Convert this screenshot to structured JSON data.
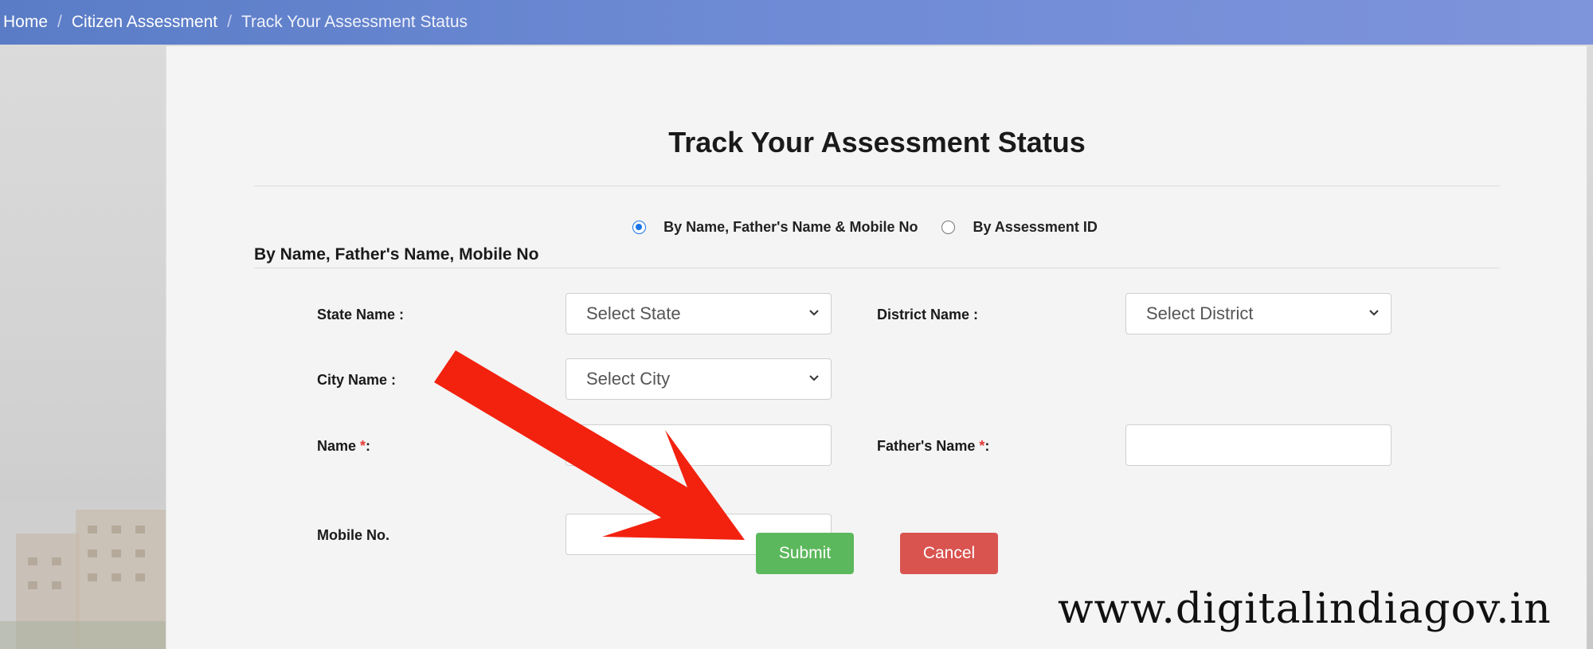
{
  "breadcrumb": {
    "items": [
      "Home",
      "Citizen Assessment",
      "Track Your Assessment Status"
    ],
    "separator": "/"
  },
  "page": {
    "title": "Track Your Assessment Status"
  },
  "search_mode": {
    "options": [
      {
        "label": "By Name, Father's Name & Mobile No",
        "selected": true
      },
      {
        "label": "By Assessment ID",
        "selected": false
      }
    ]
  },
  "form": {
    "section_heading": "By Name, Father's Name, Mobile No",
    "state_label": "State Name :",
    "state_value": "Select State",
    "district_label": "District Name :",
    "district_value": "Select District",
    "city_label": "City Name :",
    "city_value": "Select City",
    "name_label": "Name ",
    "name_required": "*",
    "name_suffix": ":",
    "father_label": "Father's Name ",
    "father_required": "*",
    "father_suffix": ":",
    "mobile_label": "Mobile No.",
    "name_value": "",
    "father_value": "",
    "mobile_value": ""
  },
  "actions": {
    "submit_label": "Submit",
    "cancel_label": "Cancel"
  },
  "colors": {
    "submit": "#5cb85c",
    "cancel": "#d9534f",
    "arrow": "#f2220f",
    "topbar": "#6f8bd6"
  },
  "watermark": {
    "text": "www.digitalindiagov.in"
  }
}
